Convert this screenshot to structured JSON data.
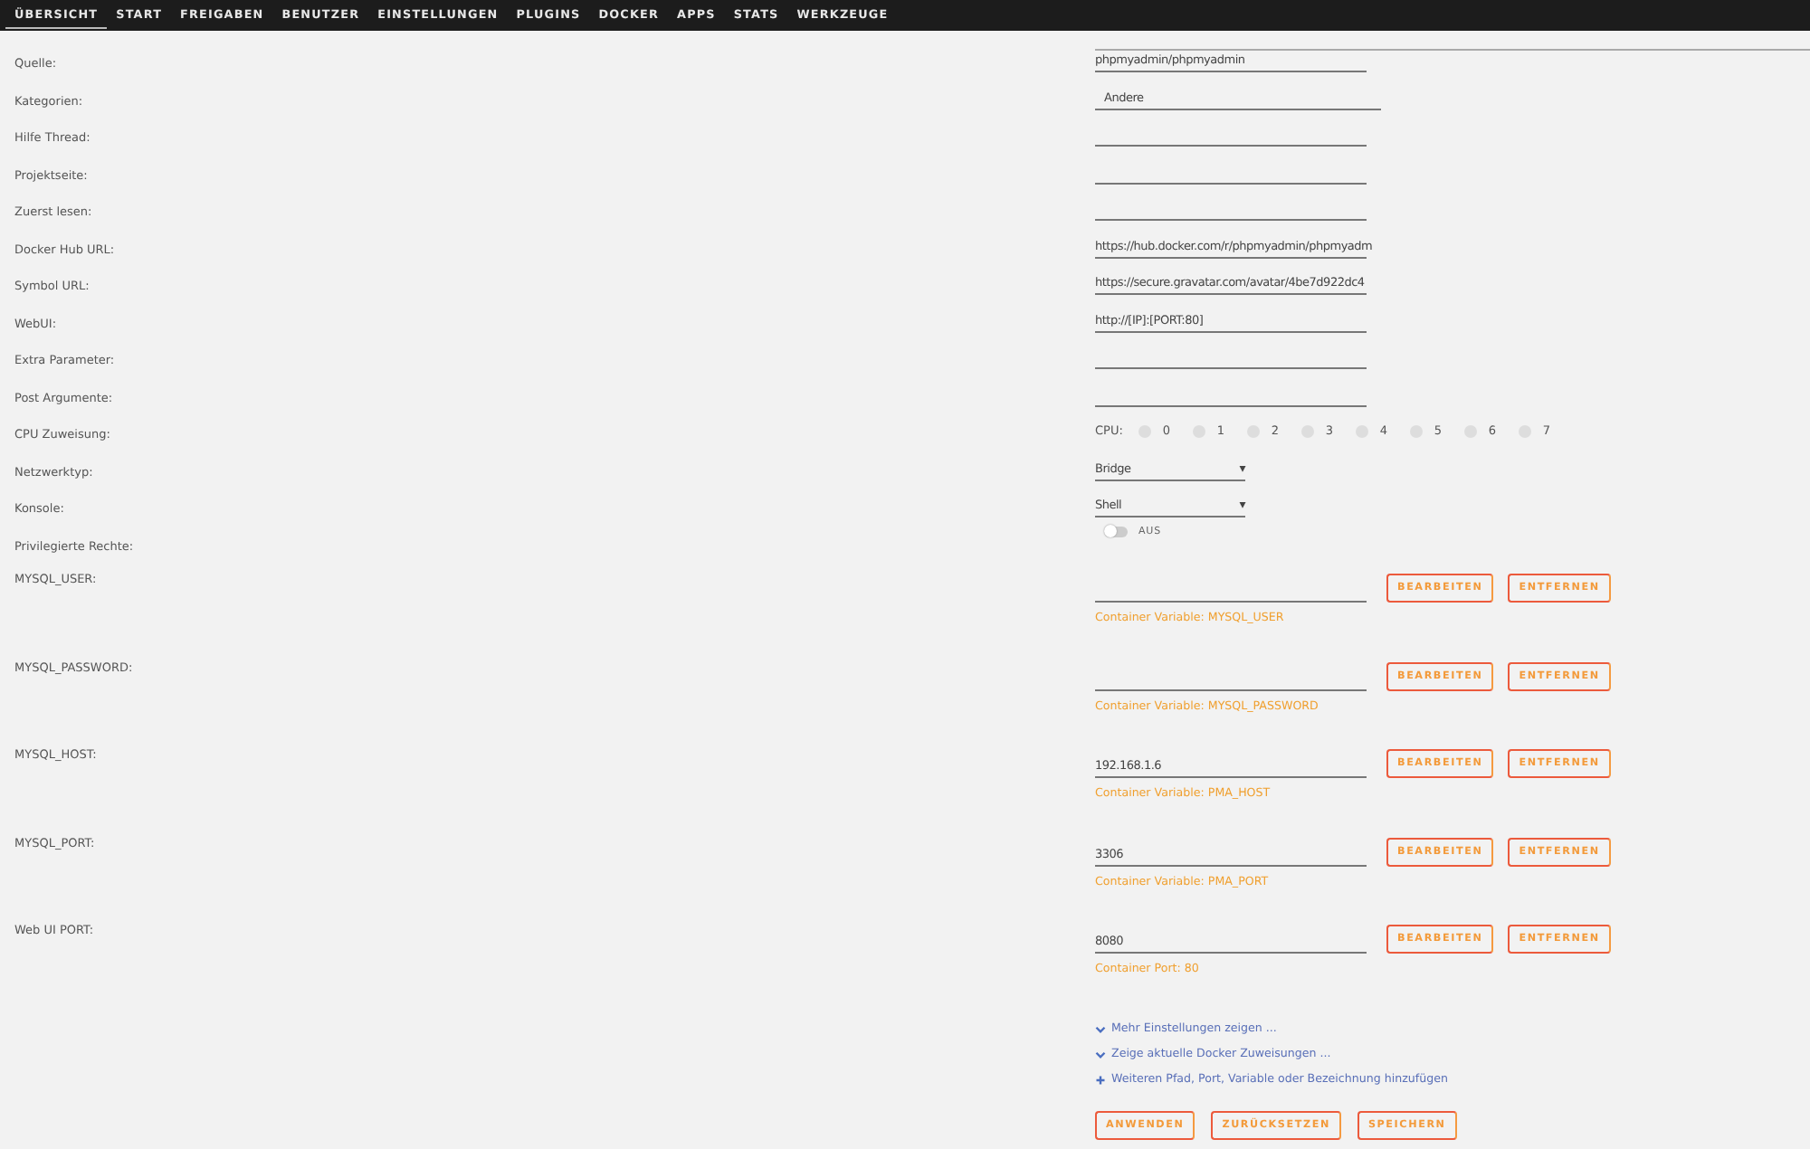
{
  "nav": [
    {
      "label": "ÜBERSICHT",
      "selected": true
    },
    {
      "label": "START",
      "selected": false
    },
    {
      "label": "FREIGABEN",
      "selected": false
    },
    {
      "label": "BENUTZER",
      "selected": false
    },
    {
      "label": "EINSTELLUNGEN",
      "selected": false
    },
    {
      "label": "PLUGINS",
      "selected": false
    },
    {
      "label": "DOCKER",
      "selected": false
    },
    {
      "label": "APPS",
      "selected": false
    },
    {
      "label": "STATS",
      "selected": false
    },
    {
      "label": "WERKZEUGE",
      "selected": false
    }
  ],
  "fields": [
    {
      "kind": "text",
      "label": "Quelle:",
      "value": "phpmyadmin/phpmyadmin"
    },
    {
      "kind": "category",
      "label": "Kategorien:",
      "value": "Andere"
    },
    {
      "kind": "text",
      "label": "Hilfe Thread:"
    },
    {
      "kind": "text",
      "label": "Projektseite:"
    },
    {
      "kind": "text",
      "label": "Zuerst lesen:"
    },
    {
      "kind": "text",
      "label": "Docker Hub URL:",
      "value": "https://hub.docker.com/r/phpmyadmin/phpmyadm"
    },
    {
      "kind": "text",
      "label": "Symbol URL:",
      "value": "https://secure.gravatar.com/avatar/4be7d922dc4"
    },
    {
      "kind": "text",
      "label": "WebUI:",
      "value": "http://[IP]:[PORT:80]"
    },
    {
      "kind": "text",
      "label": "Extra Parameter:"
    },
    {
      "kind": "text",
      "label": "Post Argumente:"
    },
    {
      "kind": "cpu",
      "label": "CPU Zuweisung:",
      "prefix": "CPU:",
      "cpus": [
        {
          "label": "0",
          "checked": false
        },
        {
          "label": "1",
          "checked": false
        },
        {
          "label": "2",
          "checked": false
        },
        {
          "label": "3",
          "checked": false
        },
        {
          "label": "4",
          "checked": false
        },
        {
          "label": "5",
          "checked": false
        },
        {
          "label": "6",
          "checked": false
        },
        {
          "label": "7",
          "checked": false
        }
      ]
    },
    {
      "kind": "select",
      "label": "Netzwerktyp:",
      "value": "Bridge",
      "arrow": "▾"
    },
    {
      "kind": "select",
      "label": "Konsole:",
      "value": "Shell",
      "arrow": "▾"
    },
    {
      "kind": "toggle",
      "label": "Privilegierte Rechte:",
      "on": false,
      "state_label": "AUS"
    }
  ],
  "variables": [
    {
      "label": "MYSQL_USER:",
      "note": "Container Variable: MYSQL_USER",
      "edit": "BEARBEITEN",
      "remove": "ENTFERNEN"
    },
    {
      "label": "MYSQL_PASSWORD:",
      "note": "Container Variable: MYSQL_PASSWORD",
      "edit": "BEARBEITEN",
      "remove": "ENTFERNEN"
    },
    {
      "label": "MYSQL_HOST:",
      "value": "192.168.1.6",
      "note": "Container Variable: PMA_HOST",
      "edit": "BEARBEITEN",
      "remove": "ENTFERNEN"
    },
    {
      "label": "MYSQL_PORT:",
      "value": "3306",
      "note": "Container Variable: PMA_PORT",
      "edit": "BEARBEITEN",
      "remove": "ENTFERNEN"
    },
    {
      "label": "Web UI PORT:",
      "value": "8080",
      "note": "Container Port: 80",
      "edit": "BEARBEITEN",
      "remove": "ENTFERNEN"
    }
  ],
  "links": [
    {
      "kind": "chevron",
      "label": "Mehr Einstellungen zeigen ..."
    },
    {
      "kind": "chevron",
      "label": "Zeige aktuelle Docker Zuweisungen ..."
    },
    {
      "kind": "plus",
      "label": "Weiteren Pfad, Port, Variable oder Bezeichnung hinzufügen"
    }
  ],
  "buttons": [
    "ANWENDEN",
    "ZURÜCKSETZEN",
    "SPEICHERN"
  ]
}
